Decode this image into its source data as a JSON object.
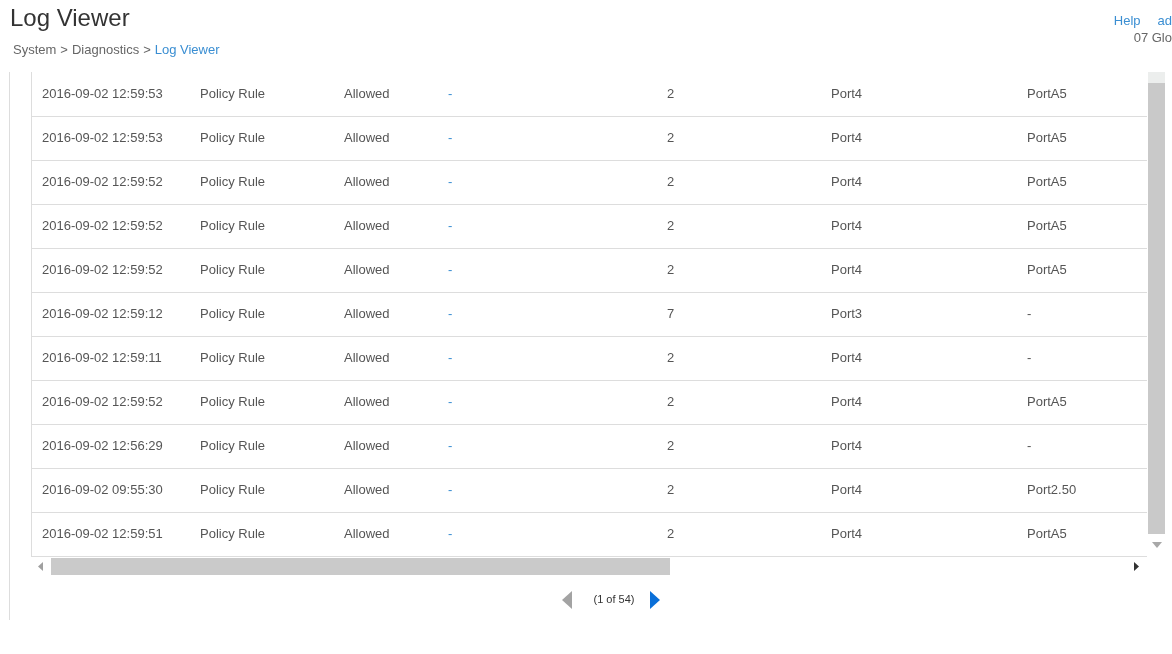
{
  "header": {
    "title": "Log Viewer",
    "breadcrumb": [
      {
        "label": "System",
        "separator": ">",
        "selected": false
      },
      {
        "label": "Diagnostics",
        "separator": ">",
        "selected": false
      },
      {
        "label": "Log Viewer",
        "selected": true
      }
    ],
    "top_links": [
      "Help",
      "ad"
    ],
    "account_info": "07 Glo"
  },
  "table": {
    "rows": [
      [
        "2016-09-02 12:59:53",
        "Policy Rule",
        "Allowed",
        "-",
        "2",
        "Port4",
        "PortA5"
      ],
      [
        "2016-09-02 12:59:53",
        "Policy Rule",
        "Allowed",
        "-",
        "2",
        "Port4",
        "PortA5"
      ],
      [
        "2016-09-02 12:59:52",
        "Policy Rule",
        "Allowed",
        "-",
        "2",
        "Port4",
        "PortA5"
      ],
      [
        "2016-09-02 12:59:52",
        "Policy Rule",
        "Allowed",
        "-",
        "2",
        "Port4",
        "PortA5"
      ],
      [
        "2016-09-02 12:59:52",
        "Policy Rule",
        "Allowed",
        "-",
        "2",
        "Port4",
        "PortA5"
      ],
      [
        "2016-09-02 12:59:12",
        "Policy Rule",
        "Allowed",
        "-",
        "7",
        "Port3",
        "-"
      ],
      [
        "2016-09-02 12:59:11",
        "Policy Rule",
        "Allowed",
        "-",
        "2",
        "Port4",
        "-"
      ],
      [
        "2016-09-02 12:59:52",
        "Policy Rule",
        "Allowed",
        "-",
        "2",
        "Port4",
        "PortA5"
      ],
      [
        "2016-09-02 12:56:29",
        "Policy Rule",
        "Allowed",
        "-",
        "2",
        "Port4",
        "-"
      ],
      [
        "2016-09-02 09:55:30",
        "Policy Rule",
        "Allowed",
        "-",
        "2",
        "Port4",
        "Port2.50"
      ],
      [
        "2016-09-02 12:59:51",
        "Policy Rule",
        "Allowed",
        "-",
        "2",
        "Port4",
        "PortA5"
      ]
    ]
  },
  "pagination": {
    "previous_disabled": true,
    "page_label": "(1 of 54)",
    "next_disabled": false
  }
}
